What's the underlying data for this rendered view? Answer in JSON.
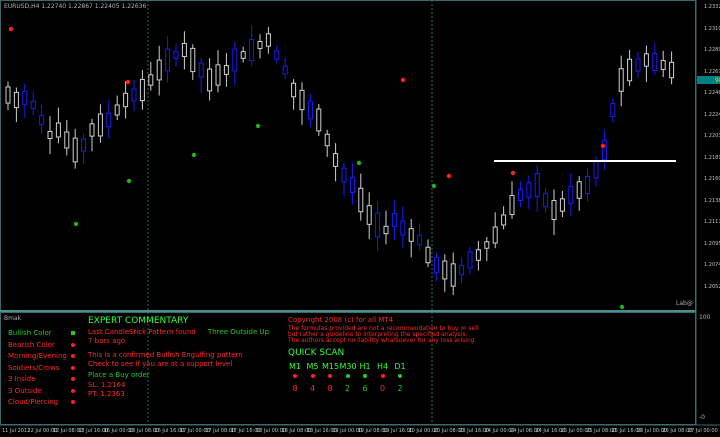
{
  "header": {
    "symbol": "EURUSD,H4  1.22740 1.22867 1.22405 1.22636"
  },
  "price_axis": [
    "1.23320",
    "1.23105",
    "1.22890",
    "1.22675",
    "1.22460",
    "1.22245",
    "1.22030",
    "1.21815",
    "1.21600",
    "1.21385",
    "1.21170",
    "1.20955",
    "1.20740",
    "1.20525"
  ],
  "current_price": "98",
  "date_axis": [
    "11 Jul 2012",
    "12 Jul 00:00",
    "12 Jul 08:00",
    "13 Jul 16:00",
    "16 Jul 00:00",
    "16 Jul 08:00",
    "16 Jul 16:00",
    "17 Jul 00:00",
    "17 Jul 08:00",
    "17 Jul 16:00",
    "18 Jul 00:00",
    "18 Jul 08:00",
    "18 Jul 16:00",
    "19 Jul 00:00",
    "19 Jul 08:00",
    "19 Jul 16:00",
    "20 Jul 00:00",
    "20 Jul 08:00",
    "23 Jul 16:00",
    "24 Jul 00:00",
    "24 Jul 08:00",
    "24 Jul 16:00",
    "25 Jul 00:00",
    "25 Jul 08:00",
    "25 Jul 16:00",
    "26 Jul 00:00",
    "26 Jul 08:00",
    "27 Jul 00:00"
  ],
  "labb_label": "Lab@",
  "sub_window": {
    "name": "Bmak",
    "right_scale_top": "100",
    "right_scale_bottom": "-0"
  },
  "patterns": {
    "items": [
      {
        "label": "Bullish Color",
        "color": "green"
      },
      {
        "label": "Bearish Color",
        "color": "red"
      },
      {
        "label": "Morning/Evening",
        "color": "red"
      },
      {
        "label": "Soldiers/Crows",
        "color": "red"
      },
      {
        "label": "3 Inside",
        "color": "red"
      },
      {
        "label": "3 Outside",
        "color": "red"
      },
      {
        "label": "Cloud/Piercing",
        "color": "red"
      }
    ]
  },
  "commentary": {
    "title": "EXPERT COMMENTARY",
    "last_pattern": "Last CandleStick Pattern found",
    "last_pattern_name": "Three Outside Up",
    "age": "7 bars ago",
    "line1": "This is a confirmed Bullish Engulfing pattern",
    "line2": "Check to see if you are at a support level",
    "action": "Place a Buy order",
    "sl": "SL: 1.2164",
    "pt": "PT: 1.2363"
  },
  "copyright": {
    "line1": "Copyright 2008 (c) for all MT4",
    "line2": "The formulas provided are not a recommendation to buy or sell",
    "line3": "but rather a guideline to interpreting the specified analysis.",
    "line4": "The authors accept no liability whatsoever for any loss arising"
  },
  "quick_scan": {
    "title": "QUICK SCAN",
    "timeframes": [
      {
        "tf": "M1",
        "value": "8",
        "color": "red"
      },
      {
        "tf": "M5",
        "value": "4",
        "color": "red"
      },
      {
        "tf": "M15",
        "value": "8",
        "color": "red"
      },
      {
        "tf": "M30",
        "value": "2",
        "color": "green"
      },
      {
        "tf": "H1",
        "value": "6",
        "color": "green"
      },
      {
        "tf": "H4",
        "value": "0",
        "color": "red"
      },
      {
        "tf": "D1",
        "value": "2",
        "color": "green"
      }
    ]
  },
  "colors": {
    "bull": "#1a1aff",
    "bear": "#ffffff",
    "bar": "#d0d0d0",
    "grid": "#1f4f4f",
    "signal_red": "#ff2020",
    "signal_green": "#20b020"
  }
}
